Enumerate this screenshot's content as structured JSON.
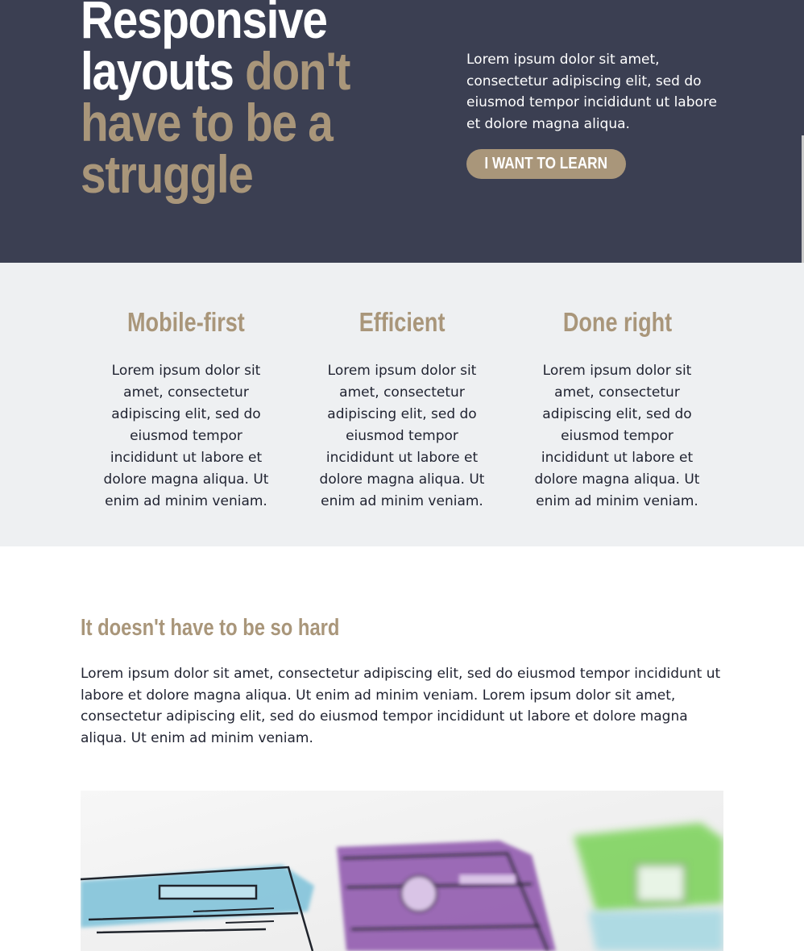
{
  "hero": {
    "title_white": "Responsive layouts ",
    "title_accent": "don't have to be a struggle",
    "text": "Lorem ipsum dolor sit amet, consectetur adipiscing elit, sed do eiusmod tempor incididunt ut labore et dolore magna aliqua.",
    "button_label": "I want to learn"
  },
  "features": [
    {
      "title": "Mobile-first",
      "text": "Lorem ipsum dolor sit amet, consectetur adipiscing elit, sed do eiusmod tempor incididunt ut labore et dolore magna aliqua. Ut enim ad minim veniam."
    },
    {
      "title": "Efficient",
      "text": "Lorem ipsum dolor sit amet, consectetur adipiscing elit, sed do eiusmod tempor incididunt ut labore et dolore magna aliqua. Ut enim ad minim veniam."
    },
    {
      "title": "Done right",
      "text": "Lorem ipsum dolor sit amet, consectetur adipiscing elit, sed do eiusmod tempor incididunt ut labore et dolore magna aliqua. Ut enim ad minim veniam."
    }
  ],
  "intro": {
    "title": "It doesn't have to be so hard",
    "text": "Lorem ipsum dolor sit amet, consectetur adipiscing elit, sed do eiusmod tempor incididunt ut labore et dolore magna aliqua. Ut enim ad minim veniam. Lorem ipsum dolor sit amet, consectetur adipiscing elit, sed do eiusmod tempor incididunt ut labore et dolore magna aliqua. Ut enim ad minim veniam."
  },
  "colors": {
    "hero_bg": "#3b3f52",
    "accent": "#a9967a",
    "features_bg": "#eef0f2",
    "text": "#1f2230"
  }
}
